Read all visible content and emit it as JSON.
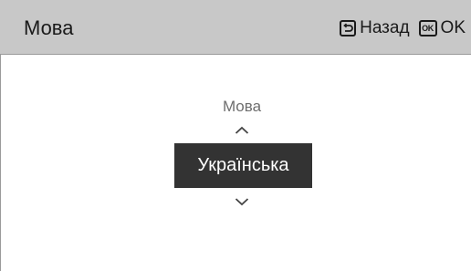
{
  "header": {
    "title": "Мова",
    "back_label": "Назад",
    "ok_icon_text": "OK",
    "ok_label": "OK"
  },
  "picker": {
    "label": "Мова",
    "selected_value": "Українська",
    "up_icon": "chevron-up-icon",
    "down_icon": "chevron-down-icon"
  },
  "colors": {
    "header_bg": "#c8c8c8",
    "selection_bg": "#333333",
    "selection_text": "#ffffff"
  }
}
